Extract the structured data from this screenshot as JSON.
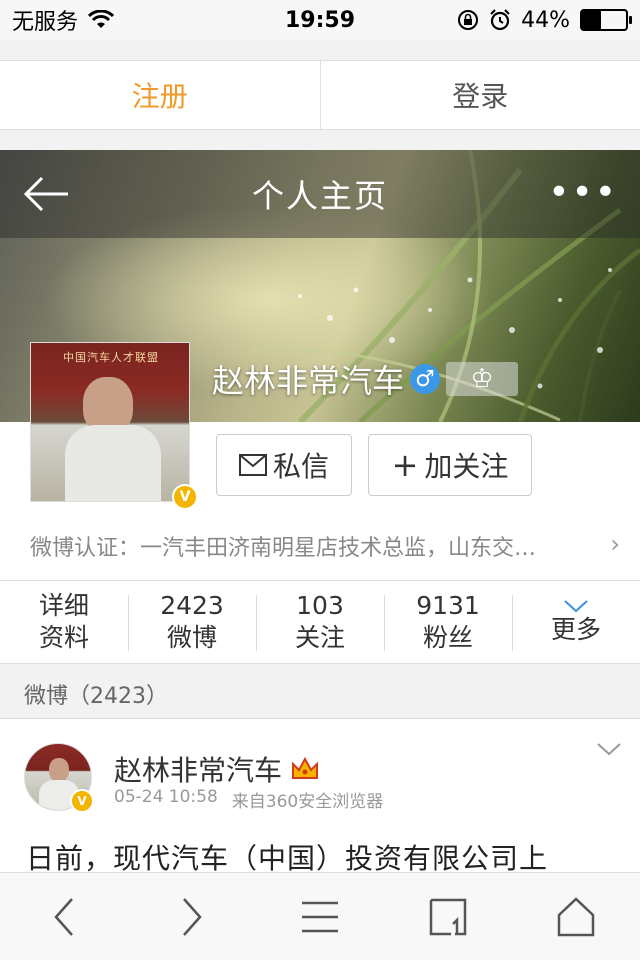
{
  "status_bar": {
    "carrier": "无服务",
    "time": "19:59",
    "battery_percent": "44%",
    "battery_level": 0.44
  },
  "auth": {
    "register_label": "注册",
    "login_label": "登录"
  },
  "header": {
    "title": "个人主页",
    "more": "•••"
  },
  "profile": {
    "name": "赵林非常汽车",
    "gender_symbol": "♂",
    "crown_symbol": "♔",
    "avatar_badge": "V",
    "avatar_banner": "中国汽车人才联盟",
    "message_label": "私信",
    "follow_label": "加关注",
    "follow_icon": "+",
    "verification": "微博认证：一汽丰田济南明星店技术总监，山东交…",
    "verification_chevron": "›"
  },
  "stats": [
    {
      "top": "详细",
      "bottom": "资料"
    },
    {
      "top": "2423",
      "bottom": "微博"
    },
    {
      "top": "103",
      "bottom": "关注"
    },
    {
      "top": "9131",
      "bottom": "粉丝"
    },
    {
      "top": "",
      "bottom": "更多"
    }
  ],
  "section": {
    "label": "微博（2423）"
  },
  "post": {
    "author": "赵林非常汽车",
    "date": "05-24 10:58",
    "source": "来自360安全浏览器",
    "text": "日前，现代汽车（中国）投资有限公司上"
  },
  "colors": {
    "accent_orange": "#f19a2a",
    "verified_gold": "#f4b400",
    "male_blue": "#3b97e8"
  },
  "icons": {
    "back": "back-arrow-icon",
    "more": "more-dots-icon",
    "mail": "mail-icon",
    "chevron_down": "chevron-down-icon",
    "toolbar": [
      "back-icon",
      "forward-icon",
      "menu-icon",
      "tabs-icon",
      "home-icon"
    ]
  }
}
